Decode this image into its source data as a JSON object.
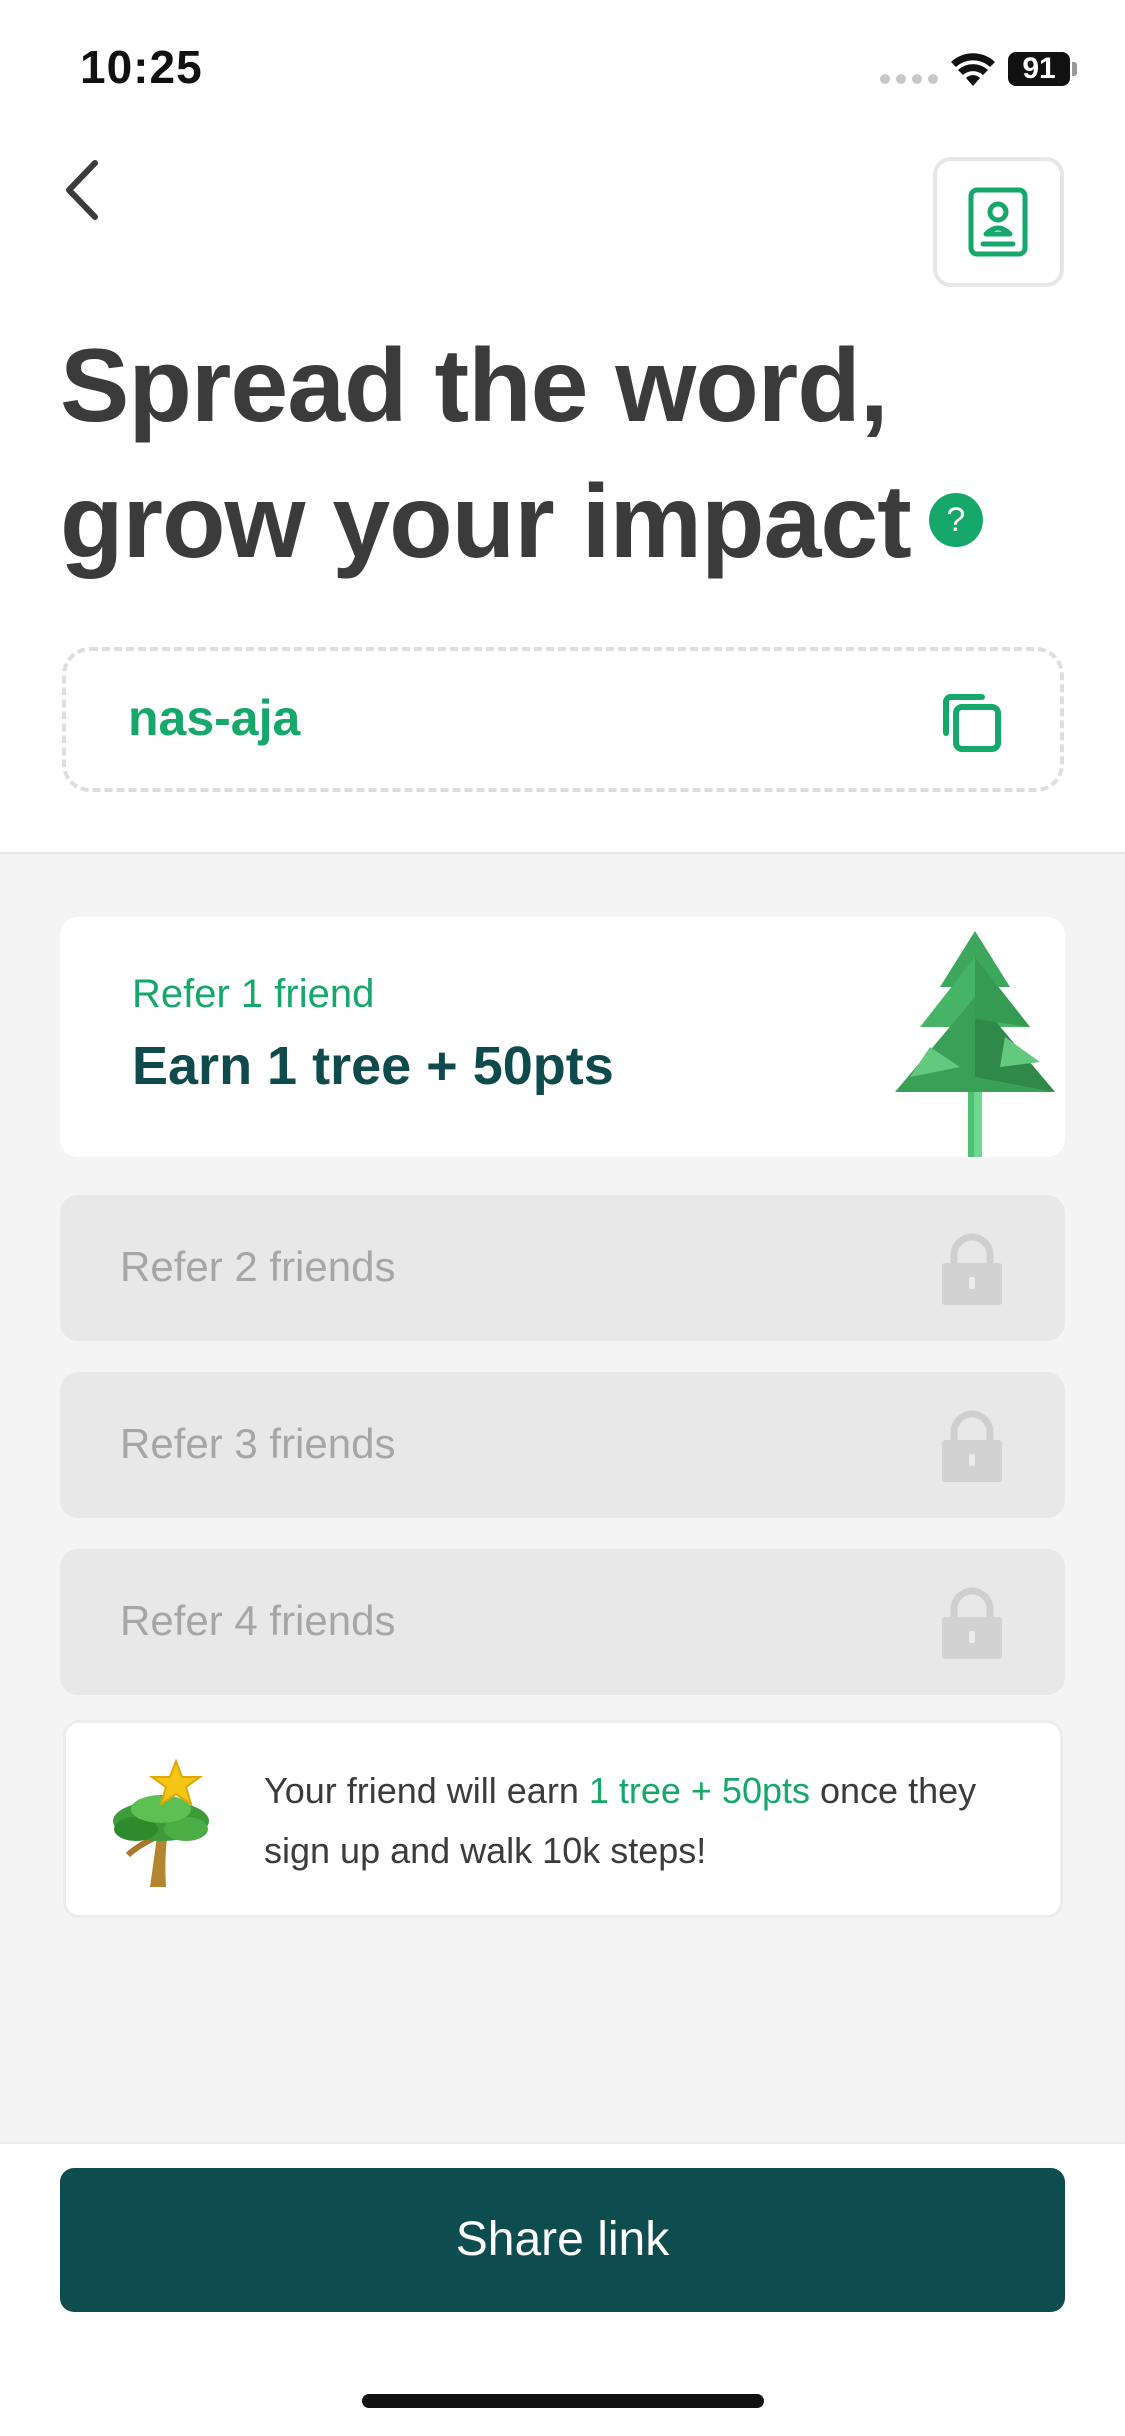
{
  "status_bar": {
    "time": "10:25",
    "battery": "91"
  },
  "header": {
    "title_line1": "Spread the word,",
    "title_line2": "grow your impact",
    "help_symbol": "?"
  },
  "referral": {
    "code": "nas-aja"
  },
  "tiers": {
    "active": {
      "subtitle": "Refer 1 friend",
      "reward": "Earn 1 tree + 50pts"
    },
    "locked": [
      {
        "label": "Refer 2 friends"
      },
      {
        "label": "Refer 3 friends"
      },
      {
        "label": "Refer 4 friends"
      }
    ]
  },
  "info": {
    "text_before": "Your friend will earn ",
    "highlight": "1 tree + 50pts",
    "text_after": " once they sign up and walk 10k steps!"
  },
  "actions": {
    "share_label": "Share link"
  },
  "colors": {
    "accent": "#15a86a",
    "primary_button": "#0e4d4f",
    "locked_bg": "#e8e8e8"
  },
  "icons": [
    "back-arrow-icon",
    "contact-book-icon",
    "help-icon",
    "copy-icon",
    "tree-icon",
    "lock-icon",
    "star-tree-icon",
    "wifi-icon",
    "battery-icon"
  ]
}
